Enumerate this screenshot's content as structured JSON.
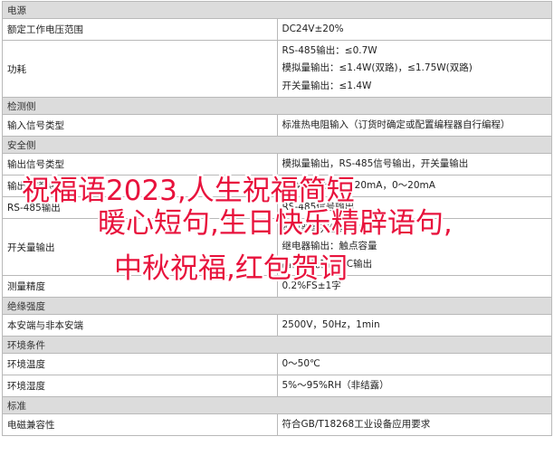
{
  "table": {
    "rows": [
      {
        "type": "section",
        "label": "电源"
      },
      {
        "type": "item",
        "label": "额定工作电压范围",
        "values": [
          "DC24V±20%"
        ]
      },
      {
        "type": "item",
        "label": "功耗",
        "values": [
          "RS-485输出：≤0.7W",
          "模拟量输出：≤1.4W(双路)，≤1.75W(双路)",
          "开关量输出：≤1.4W"
        ]
      },
      {
        "type": "section",
        "label": "检测侧"
      },
      {
        "type": "item",
        "label": "输入信号类型",
        "values": [
          "标准热电阻输入（订货时确定或配置编程器自行编程）"
        ]
      },
      {
        "type": "section",
        "label": "安全侧"
      },
      {
        "type": "item",
        "label": "输出信号类型",
        "values": [
          "模拟量输出，RS-485信号输出，开关量输出"
        ]
      },
      {
        "type": "item",
        "label": "输出通道特性",
        "values": [
          "模拟量输出：4～20mA，0～20mA"
        ]
      },
      {
        "type": "item",
        "label": "RS-485输出",
        "values": [
          "RS-485信号输出"
        ]
      },
      {
        "type": "item",
        "label": "开关量输出",
        "values": [
          "继电器常开触点输出",
          "继电器输出：触点容量",
          "晶体管光耦：OC输出"
        ]
      },
      {
        "type": "item",
        "label": "测量精度",
        "values": [
          "0.2%FS±1字"
        ]
      },
      {
        "type": "section",
        "label": "绝缘强度"
      },
      {
        "type": "item",
        "label": "本安端与非本安端",
        "values": [
          "2500V，50Hz，1min"
        ]
      },
      {
        "type": "section",
        "label": "环境条件"
      },
      {
        "type": "item",
        "label": "环境温度",
        "values": [
          "0～50℃"
        ]
      },
      {
        "type": "item",
        "label": "环境湿度",
        "values": [
          "5%～95%RH（非结露）"
        ]
      },
      {
        "type": "section",
        "label": "标准"
      },
      {
        "type": "item",
        "label": "电磁兼容性",
        "values": [
          "符合GB/T18268工业设备应用要求"
        ]
      }
    ]
  },
  "overlay": {
    "lines": [
      "祝福语2023,人生祝福简短",
      "暖心短句,生日快乐精辟语句,",
      "中秋祝福,红包贺词"
    ],
    "color": "#e8123c"
  }
}
